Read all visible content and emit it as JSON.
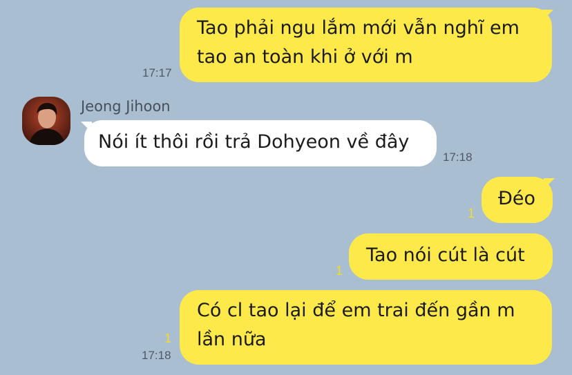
{
  "contact": {
    "name": "Jeong Jihoon"
  },
  "messages": [
    {
      "side": "me",
      "text": "Tao phải ngu lắm mới vẫn nghĩ em tao an toàn khi ở với m",
      "time": "17:17",
      "unread": ""
    },
    {
      "side": "them",
      "text": "Nói ít thôi rồi trả Dohyeon về đây",
      "time": "17:18",
      "unread": ""
    },
    {
      "side": "me",
      "text": "Đéo",
      "time": "",
      "unread": "1"
    },
    {
      "side": "me",
      "text": "Tao nói cút là cút",
      "time": "",
      "unread": "1"
    },
    {
      "side": "me",
      "text": "Có cl tao lại để em trai đến gần m lần nữa",
      "time": "17:18",
      "unread": "1"
    }
  ],
  "colors": {
    "background": "#aabed1",
    "my_bubble": "#fee94b",
    "their_bubble": "#ffffff",
    "unread_count": "#f3dc2f"
  }
}
